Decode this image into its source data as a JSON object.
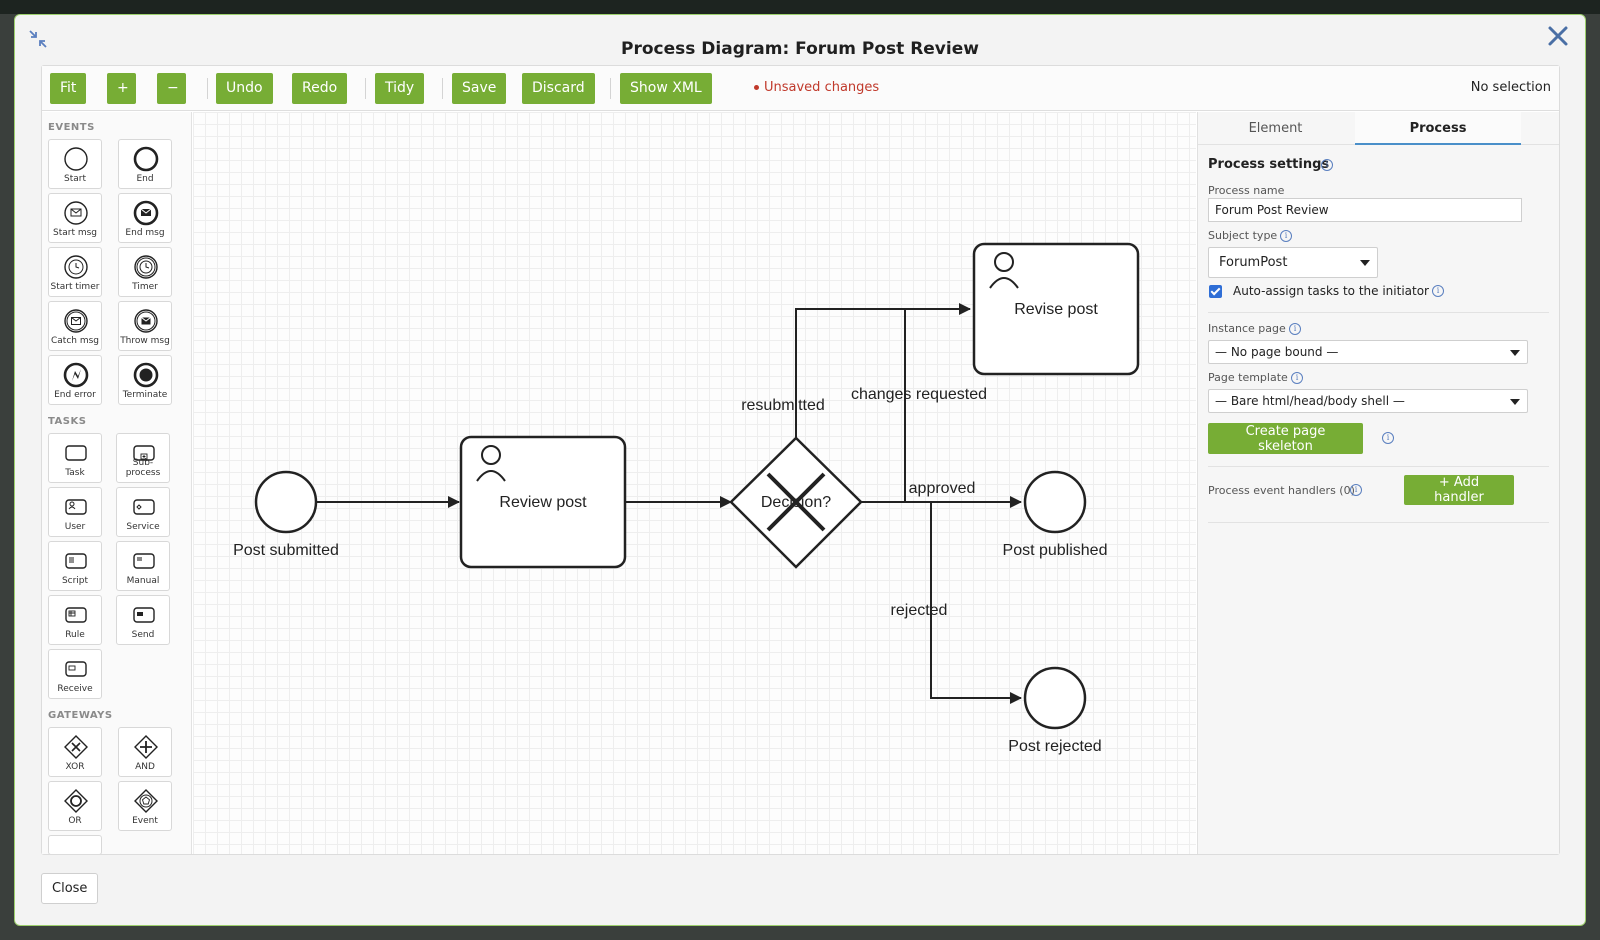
{
  "modal": {
    "title": "Process Diagram: Forum Post Review",
    "close_label": "Close"
  },
  "toolbar": {
    "fit": "Fit",
    "zoom_in": "+",
    "zoom_out": "−",
    "undo": "Undo",
    "redo": "Redo",
    "tidy": "Tidy",
    "save": "Save",
    "discard": "Discard",
    "show_xml": "Show XML",
    "unsaved": "Unsaved changes",
    "selection": "No selection"
  },
  "palette": {
    "events_heading": "EVENTS",
    "tasks_heading": "TASKS",
    "gateways_heading": "GATEWAYS",
    "events": [
      {
        "label": "Start",
        "icon": "start-event-icon"
      },
      {
        "label": "End",
        "icon": "end-event-icon"
      },
      {
        "label": "Start msg",
        "icon": "start-message-icon"
      },
      {
        "label": "End msg",
        "icon": "end-message-icon"
      },
      {
        "label": "Start timer",
        "icon": "start-timer-icon"
      },
      {
        "label": "Timer",
        "icon": "timer-icon"
      },
      {
        "label": "Catch msg",
        "icon": "catch-message-icon"
      },
      {
        "label": "Throw msg",
        "icon": "throw-message-icon"
      },
      {
        "label": "End error",
        "icon": "end-error-icon"
      },
      {
        "label": "Terminate",
        "icon": "terminate-icon"
      }
    ],
    "tasks": [
      {
        "label": "Task",
        "icon": "task-icon"
      },
      {
        "label": "Sub-process",
        "icon": "subprocess-icon"
      },
      {
        "label": "User",
        "icon": "user-task-icon"
      },
      {
        "label": "Service",
        "icon": "service-task-icon"
      },
      {
        "label": "Script",
        "icon": "script-task-icon"
      },
      {
        "label": "Manual",
        "icon": "manual-task-icon"
      },
      {
        "label": "Rule",
        "icon": "rule-task-icon"
      },
      {
        "label": "Send",
        "icon": "send-task-icon"
      },
      {
        "label": "Receive",
        "icon": "receive-task-icon"
      }
    ],
    "gateways": [
      {
        "label": "XOR",
        "icon": "xor-gateway-icon"
      },
      {
        "label": "AND",
        "icon": "and-gateway-icon"
      },
      {
        "label": "OR",
        "icon": "or-gateway-icon"
      },
      {
        "label": "Event",
        "icon": "event-gateway-icon"
      }
    ]
  },
  "diagram": {
    "start_event": "Post submitted",
    "review_task": "Review post",
    "gateway": "Decision?",
    "revise_task": "Revise post",
    "published_event": "Post published",
    "rejected_event": "Post rejected",
    "flow_resubmitted": "resubmitted",
    "flow_changes": "changes requested",
    "flow_approved": "approved",
    "flow_rejected": "rejected"
  },
  "properties": {
    "tab_element": "Element",
    "tab_process": "Process",
    "section_title": "Process settings",
    "process_name_label": "Process name",
    "process_name_value": "Forum Post Review",
    "subject_type_label": "Subject type",
    "subject_type_value": "ForumPost",
    "auto_assign_label": "Auto-assign tasks to the initiator",
    "instance_page_label": "Instance page",
    "instance_page_value": "— No page bound —",
    "page_template_label": "Page template",
    "page_template_value": "— Bare html/head/body shell —",
    "create_skeleton": "Create page skeleton",
    "handlers_label": "Process event handlers (0)",
    "add_handler": "+ Add handler"
  },
  "colors": {
    "accent_green": "#77ad35",
    "unsaved_red": "#c0392b",
    "tab_underline": "#4a8fc9"
  }
}
